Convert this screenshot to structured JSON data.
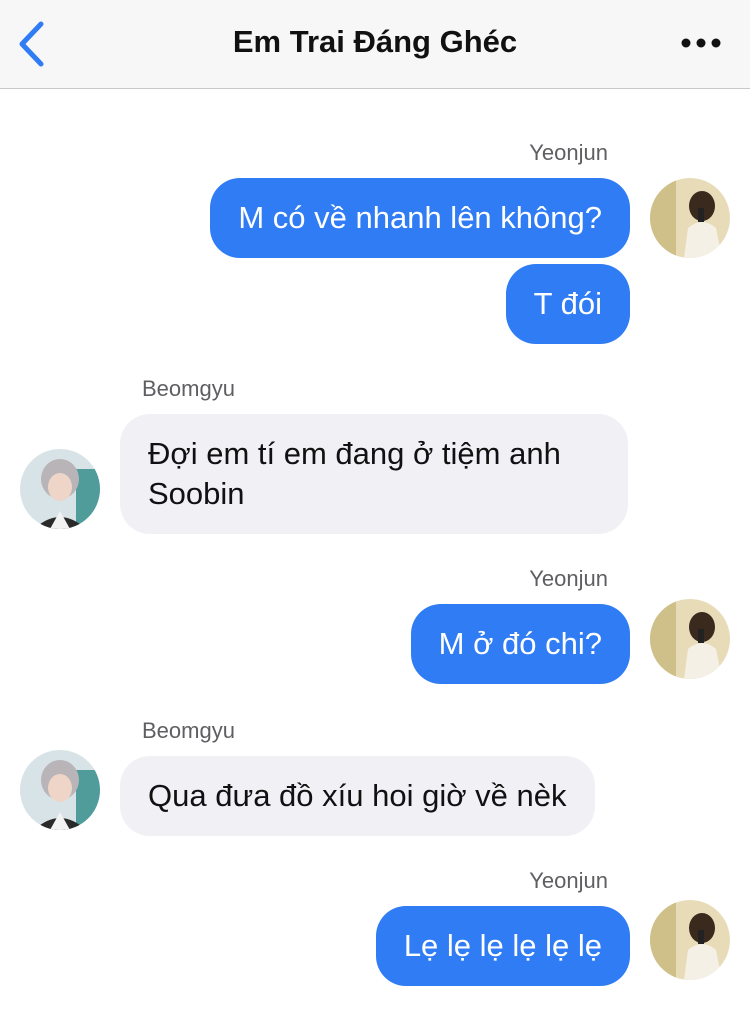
{
  "header": {
    "title": "Em Trai Đáng Ghéc",
    "back_icon": "chevron-left-icon",
    "more_icon": "more-horizontal-icon",
    "accent": "#2f7cf5"
  },
  "colors": {
    "outgoing_bubble": "#2f7cf5",
    "incoming_bubble": "#f0f0f5"
  },
  "messages": [
    {
      "sender": "Yeonjun",
      "direction": "out",
      "lines": [
        "M có về nhanh lên không?"
      ]
    },
    {
      "sender": "Yeonjun",
      "direction": "out",
      "lines": [
        "T đói"
      ]
    },
    {
      "sender": "Beomgyu",
      "direction": "in",
      "lines": [
        "Đợi em tí em đang ở tiệm anh",
        "Soobin"
      ]
    },
    {
      "sender": "Yeonjun",
      "direction": "out",
      "lines": [
        "M ở đó chi?"
      ]
    },
    {
      "sender": "Beomgyu",
      "direction": "in",
      "lines": [
        "Qua đưa đồ xíu hoi giờ về nèk"
      ]
    },
    {
      "sender": "Yeonjun",
      "direction": "out",
      "lines": [
        "Lẹ lẹ lẹ lẹ lẹ lẹ"
      ]
    }
  ]
}
